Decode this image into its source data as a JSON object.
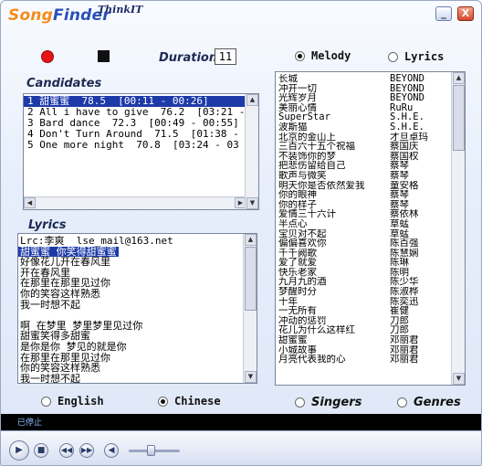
{
  "app": {
    "logo_part1": "Song",
    "logo_part2": "Finder",
    "brand": "ThinkIT",
    "minimize_label": "_",
    "close_label": "X"
  },
  "controls": {
    "duration_label": "Duration",
    "duration_value": "11",
    "search_mode": {
      "melody_label": "Melody",
      "lyrics_label": "Lyrics",
      "selected": "melody"
    }
  },
  "candidates": {
    "label": "Candidates",
    "selected_index": 0,
    "rows": [
      "1 甜蜜蜜  78.5  [00:11 - 00:26]",
      "2 All i have to give  76.2  [03:21 -",
      "3 Bard dance  72.3  [00:49 - 00:55]",
      "4 Don't Turn Around  71.5  [01:38 -",
      "5 One more night  70.8  [03:24 - 03"
    ]
  },
  "lyrics": {
    "label": "Lyrics",
    "lines": [
      "Lrc:李爽  lse_mail@163.net",
      "甜蜜蜜 你笑得甜蜜蜜",
      "好像花儿开在春风里",
      "开在春风里",
      "在那里在那里见过你",
      "你的笑容这样熟悉",
      "我一时想不起",
      "",
      "啊 在梦里 梦里梦里见过你",
      "甜蜜笑得多甜蜜",
      "是你是你 梦见的就是你",
      "在那里在那里见过你",
      "你的笑容这样熟悉",
      "我一时想不起"
    ],
    "highlighted_line": 1,
    "language": {
      "english_label": "English",
      "chinese_label": "Chinese",
      "selected": "chinese"
    }
  },
  "songs": {
    "rows": [
      {
        "title": "长城",
        "singer": "BEYOND"
      },
      {
        "title": "冲开一切",
        "singer": "BEYOND"
      },
      {
        "title": "光辉岁月",
        "singer": "BEYOND"
      },
      {
        "title": "美丽心情",
        "singer": "RuRu"
      },
      {
        "title": "SuperStar",
        "singer": "S.H.E."
      },
      {
        "title": "波斯猫",
        "singer": "S.H.E."
      },
      {
        "title": "北京的金山上",
        "singer": "才旦卓玛"
      },
      {
        "title": "三百六十五个祝福",
        "singer": "蔡国庆"
      },
      {
        "title": "不装饰你的梦",
        "singer": "蔡国权"
      },
      {
        "title": "把悲伤留给自己",
        "singer": "蔡琴"
      },
      {
        "title": "歌声与微笑",
        "singer": "蔡琴"
      },
      {
        "title": "明天你是否依然爱我",
        "singer": "童安格"
      },
      {
        "title": "你的眼神",
        "singer": "蔡琴"
      },
      {
        "title": "你的样子",
        "singer": "蔡琴"
      },
      {
        "title": "爱情三十六计",
        "singer": "蔡依林"
      },
      {
        "title": "半点心",
        "singer": "草蜢"
      },
      {
        "title": "宝贝对不起",
        "singer": "草蜢"
      },
      {
        "title": "偏偏喜欢你",
        "singer": "陈百强"
      },
      {
        "title": "千千阙歌",
        "singer": "陈慧娴"
      },
      {
        "title": "爱了就爱",
        "singer": "陈琳"
      },
      {
        "title": "快乐老家",
        "singer": "陈明"
      },
      {
        "title": "九月九的酒",
        "singer": "陈少华"
      },
      {
        "title": "梦醒时分",
        "singer": "陈淑桦"
      },
      {
        "title": "十年",
        "singer": "陈奕迅"
      },
      {
        "title": "一无所有",
        "singer": "崔健"
      },
      {
        "title": "冲动的惩罚",
        "singer": "刀郎"
      },
      {
        "title": "花儿为什么这样红",
        "singer": "刀郎"
      },
      {
        "title": "甜蜜蜜",
        "singer": "邓丽君"
      },
      {
        "title": "小城故事",
        "singer": "邓丽君"
      },
      {
        "title": "月亮代表我的心",
        "singer": "邓丽君"
      }
    ],
    "sort": {
      "singers_label": "Singers",
      "genres_label": "Genres",
      "selected": "none"
    }
  },
  "player": {
    "status_text": "已停止"
  }
}
